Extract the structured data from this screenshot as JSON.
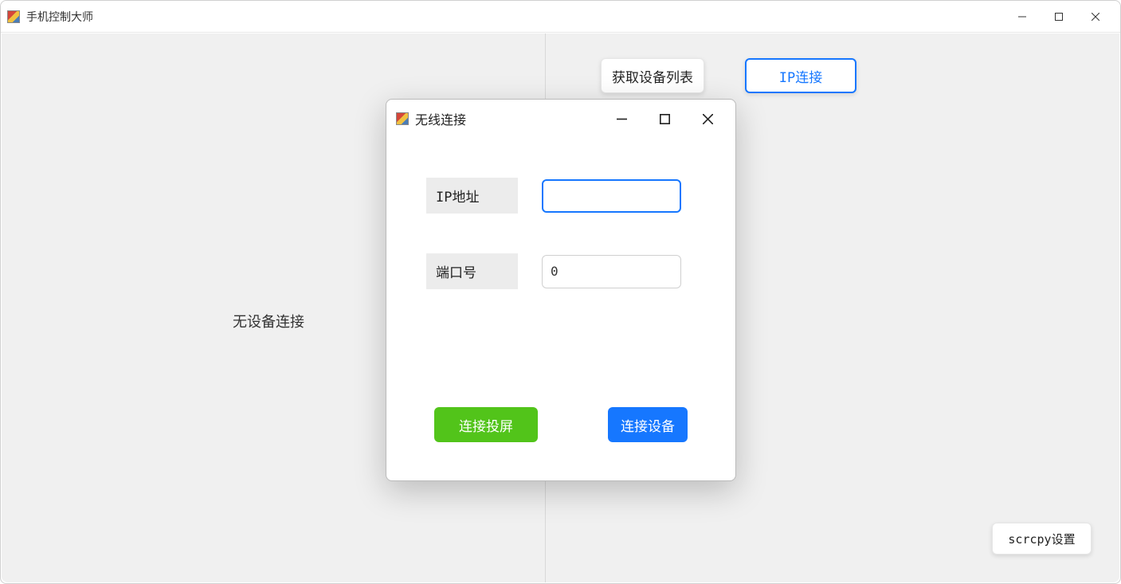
{
  "main_window": {
    "title": "手机控制大师"
  },
  "main_area": {
    "no_device_text": "无设备连接",
    "get_devices_button": "获取设备列表",
    "ip_connect_button": "IP连接",
    "scrcpy_settings_button": "scrcpy设置"
  },
  "dialog": {
    "title": "无线连接",
    "ip_label": "IP地址",
    "ip_value": "",
    "port_label": "端口号",
    "port_value": "0",
    "connect_cast_button": "连接投屏",
    "connect_device_button": "连接设备"
  }
}
